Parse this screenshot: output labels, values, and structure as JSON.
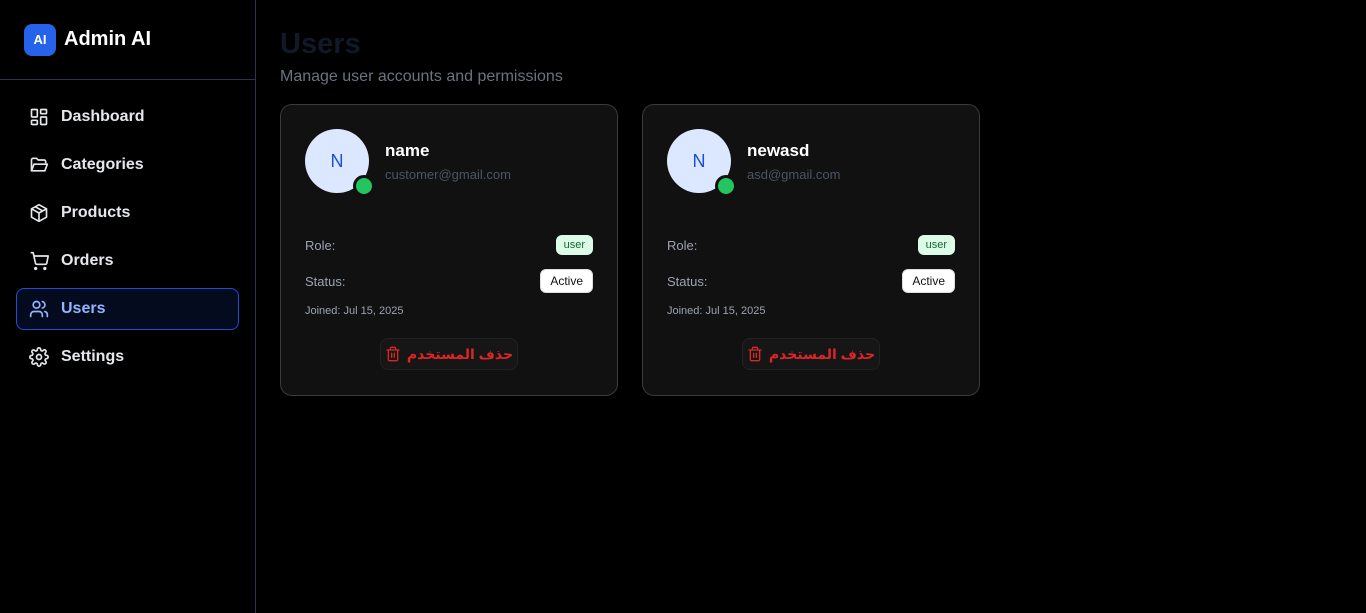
{
  "brand": {
    "logo_text": "AI",
    "name": "Admin AI"
  },
  "sidebar": {
    "items": [
      {
        "label": "Dashboard",
        "icon": "layout-grid-icon"
      },
      {
        "label": "Categories",
        "icon": "folder-open-icon"
      },
      {
        "label": "Products",
        "icon": "package-icon"
      },
      {
        "label": "Orders",
        "icon": "shopping-cart-icon"
      },
      {
        "label": "Users",
        "icon": "users-icon",
        "active": true
      },
      {
        "label": "Settings",
        "icon": "gear-icon"
      }
    ]
  },
  "page": {
    "title": "Users",
    "subtitle": "Manage user accounts and permissions"
  },
  "labels": {
    "role": "Role:",
    "status": "Status:"
  },
  "users": [
    {
      "initial": "N",
      "name": "name",
      "email": "customer@gmail.com",
      "role": "user",
      "status": "Active",
      "joined": "Joined: Jul 15, 2025",
      "delete_label": "حذف المستخدم"
    },
    {
      "initial": "N",
      "name": "newasd",
      "email": "asd@gmail.com",
      "role": "user",
      "status": "Active",
      "joined": "Joined: Jul 15, 2025",
      "delete_label": "حذف المستخدم"
    }
  ],
  "colors": {
    "accent": "#2563eb",
    "online": "#22c55e",
    "danger": "#dc2626",
    "role_badge_bg": "#dcfce7"
  }
}
